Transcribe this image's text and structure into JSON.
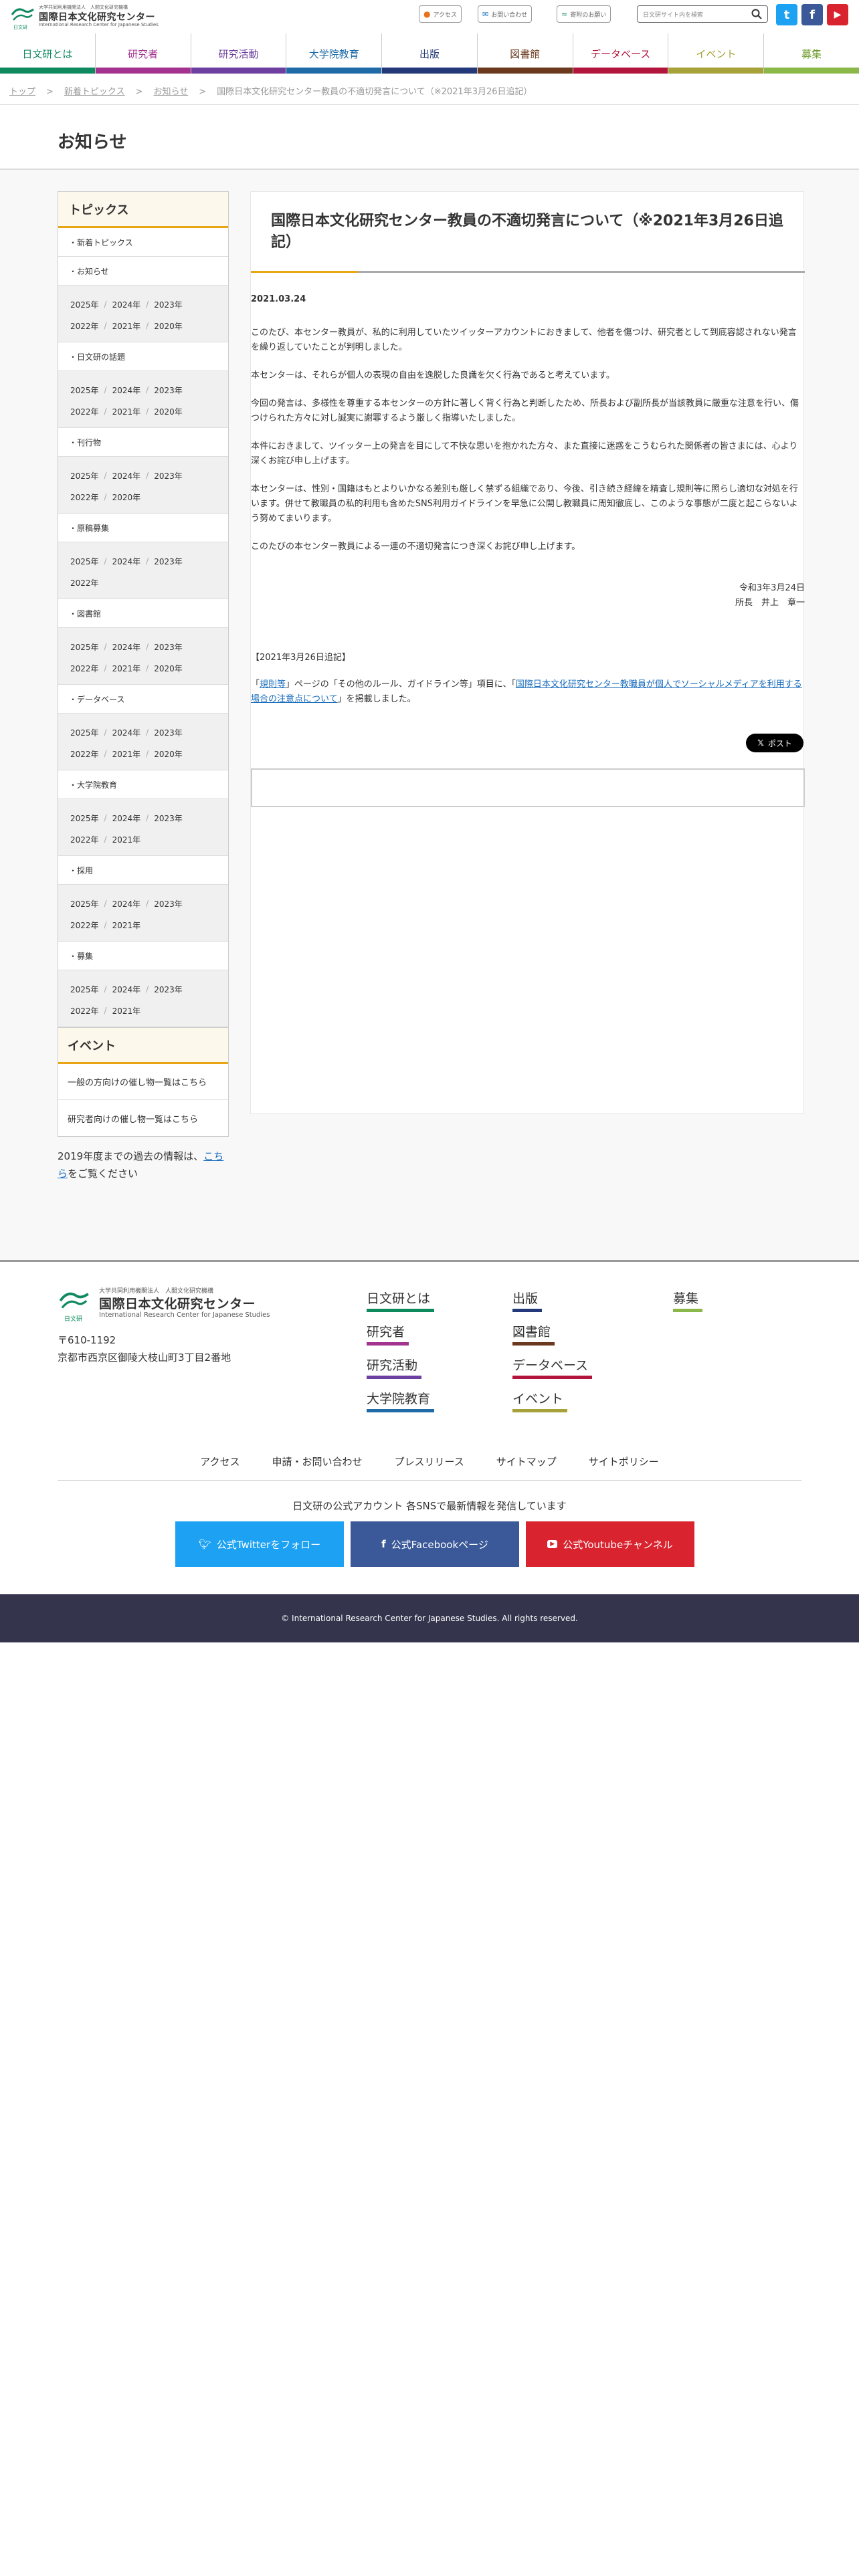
{
  "header": {
    "logo_sub": "大学共同利用機関法人　人間文化研究機構",
    "logo_main": "国際日本文化研究センター",
    "logo_en": "International Research Center for Japanese Studies",
    "logo_tag": "日文研",
    "util": [
      "アクセス",
      "お問い合わせ",
      "寄附のお願い"
    ],
    "search_placeholder": "日文研サイト内を検索",
    "sns": [
      "t",
      "f",
      "▶"
    ]
  },
  "gnav": [
    {
      "label": "日文研とは",
      "color": "#0f8a5f",
      "text": "#0f8a5f"
    },
    {
      "label": "研究者",
      "color": "#a3338f",
      "text": "#a3338f"
    },
    {
      "label": "研究活動",
      "color": "#6d3fa0",
      "text": "#6d3fa0"
    },
    {
      "label": "大学院教育",
      "color": "#1e6ba8",
      "text": "#1e6ba8"
    },
    {
      "label": "出版",
      "color": "#23397a",
      "text": "#23397a"
    },
    {
      "label": "図書館",
      "color": "#6b3a1e",
      "text": "#6b3a1e"
    },
    {
      "label": "データベース",
      "color": "#b3143c",
      "text": "#b3143c"
    },
    {
      "label": "イベント",
      "color": "#a7a13a",
      "text": "#a7a13a"
    },
    {
      "label": "募集",
      "color": "#8cb84a",
      "text": "#6f9d2f"
    }
  ],
  "breadcrumb": [
    "トップ",
    "新着トピックス",
    "お知らせ",
    "国際日本文化研究センター教員の不適切発言について（※2021年3月26日追記）"
  ],
  "page_title": "お知らせ",
  "sidebar": {
    "head": "トピックス",
    "sections": [
      {
        "label": "・新着トピックス",
        "rows": []
      },
      {
        "label": "・お知らせ",
        "rows": [
          [
            "2025年",
            "2024年",
            "2023年"
          ],
          [
            "2022年",
            "2021年",
            "2020年"
          ]
        ]
      },
      {
        "label": "・日文研の話題",
        "rows": [
          [
            "2025年",
            "2024年",
            "2023年"
          ],
          [
            "2022年",
            "2021年",
            "2020年"
          ]
        ]
      },
      {
        "label": "・刊行物",
        "rows": [
          [
            "2025年",
            "2024年",
            "2023年"
          ],
          [
            "2022年",
            "2020年"
          ]
        ]
      },
      {
        "label": "・原稿募集",
        "rows": [
          [
            "2025年",
            "2024年",
            "2023年"
          ],
          [
            "2022年"
          ]
        ]
      },
      {
        "label": "・図書館",
        "rows": [
          [
            "2025年",
            "2024年",
            "2023年"
          ],
          [
            "2022年",
            "2021年",
            "2020年"
          ]
        ]
      },
      {
        "label": "・データベース",
        "rows": [
          [
            "2025年",
            "2024年",
            "2023年"
          ],
          [
            "2022年",
            "2021年",
            "2020年"
          ]
        ]
      },
      {
        "label": "・大学院教育",
        "rows": [
          [
            "2025年",
            "2024年",
            "2023年"
          ],
          [
            "2022年",
            "2021年"
          ]
        ]
      },
      {
        "label": "・採用",
        "rows": [
          [
            "2025年",
            "2024年",
            "2023年"
          ],
          [
            "2022年",
            "2021年"
          ]
        ]
      },
      {
        "label": "・募集",
        "rows": [
          [
            "2025年",
            "2024年",
            "2023年"
          ],
          [
            "2022年",
            "2021年"
          ]
        ]
      }
    ],
    "event_head": "イベント",
    "event_links": [
      "一般の方向けの催し物一覧はこちら",
      "研究者向けの催し物一覧はこちら"
    ],
    "past_pre": "2019年度までの過去の情報は、",
    "past_link": "こちら",
    "past_post": "をご覧ください"
  },
  "article": {
    "title": "国際日本文化研究センター教員の不適切発言について（※2021年3月26日追記）",
    "date": "2021.03.24",
    "paragraphs": [
      "このたび、本センター教員が、私的に利用していたツイッターアカウントにおきまして、他者を傷つけ、研究者として到底容認されない発言を繰り返していたことが判明しました。",
      "本センターは、それらが個人の表現の自由を逸脱した良識を欠く行為であると考えています。",
      "今回の発言は、多様性を尊重する本センターの方針に著しく背く行為と判断したため、所長および副所長が当該教員に厳重な注意を行い、傷つけられた方々に対し誠実に謝罪するよう厳しく指導いたしました。",
      "本件におきまして、ツイッター上の発言を目にして不快な思いを抱かれた方々、また直接に迷惑をこうむられた関係者の皆さまには、心より深くお詫び申し上げます。",
      "本センターは、性別・国籍はもとよりいかなる差別も厳しく禁ずる組織であり、今後、引き続き経緯を精査し規則等に照らし適切な対処を行います。併せて教職員の私的利用も含めたSNS利用ガイドラインを早急に公開し教職員に周知徹底し、このような事態が二度と起こらないよう努めてまいります。",
      "このたびの本センター教員による一連の不適切発言につき深くお詫び申し上げます。"
    ],
    "sign_date": "令和3年3月24日",
    "sign_name": "所長　井上　章一",
    "addendum_head": "【2021年3月26日追記】",
    "addendum_pre": "「",
    "addendum_link1": "規則等",
    "addendum_mid": "」ページの「その他のルール、ガイドライン等」項目に、「",
    "addendum_link2": "国際日本文化研究センター教職員が個人でソーシャルメディアを利用する場合の注意点について",
    "addendum_post": "」を掲載しました。",
    "post_label": "ポスト"
  },
  "footer": {
    "address": [
      "〒610-1192",
      "京都市西京区御陵大枝山町3丁目2番地"
    ],
    "nav_col1": [
      {
        "label": "日文研とは",
        "color": "#0f8a5f"
      },
      {
        "label": "研究者",
        "color": "#a3338f"
      },
      {
        "label": "研究活動",
        "color": "#6d3fa0"
      },
      {
        "label": "大学院教育",
        "color": "#1e6ba8"
      }
    ],
    "nav_col2": [
      {
        "label": "出版",
        "color": "#23397a"
      },
      {
        "label": "図書館",
        "color": "#6b3a1e"
      },
      {
        "label": "データベース",
        "color": "#b3143c"
      },
      {
        "label": "イベント",
        "color": "#a7a13a"
      }
    ],
    "nav_col3": [
      {
        "label": "募集",
        "color": "#8cb84a"
      }
    ],
    "links": [
      "アクセス",
      "申請・お問い合わせ",
      "プレスリリース",
      "サイトマップ",
      "サイトポリシー"
    ],
    "note": "日文研の公式アカウント 各SNSで最新情報を発信しています",
    "buttons": [
      {
        "label": "公式Twitterをフォロー",
        "color": "#1da1f2",
        "icon": "bird-icon"
      },
      {
        "label": "公式Facebookページ",
        "color": "#3b5998",
        "icon": "facebook-icon"
      },
      {
        "label": "公式Youtubeチャンネル",
        "color": "#d9232e",
        "icon": "youtube-icon"
      }
    ],
    "copyright": "© International Research Center for Japanese Studies. All rights reserved."
  }
}
